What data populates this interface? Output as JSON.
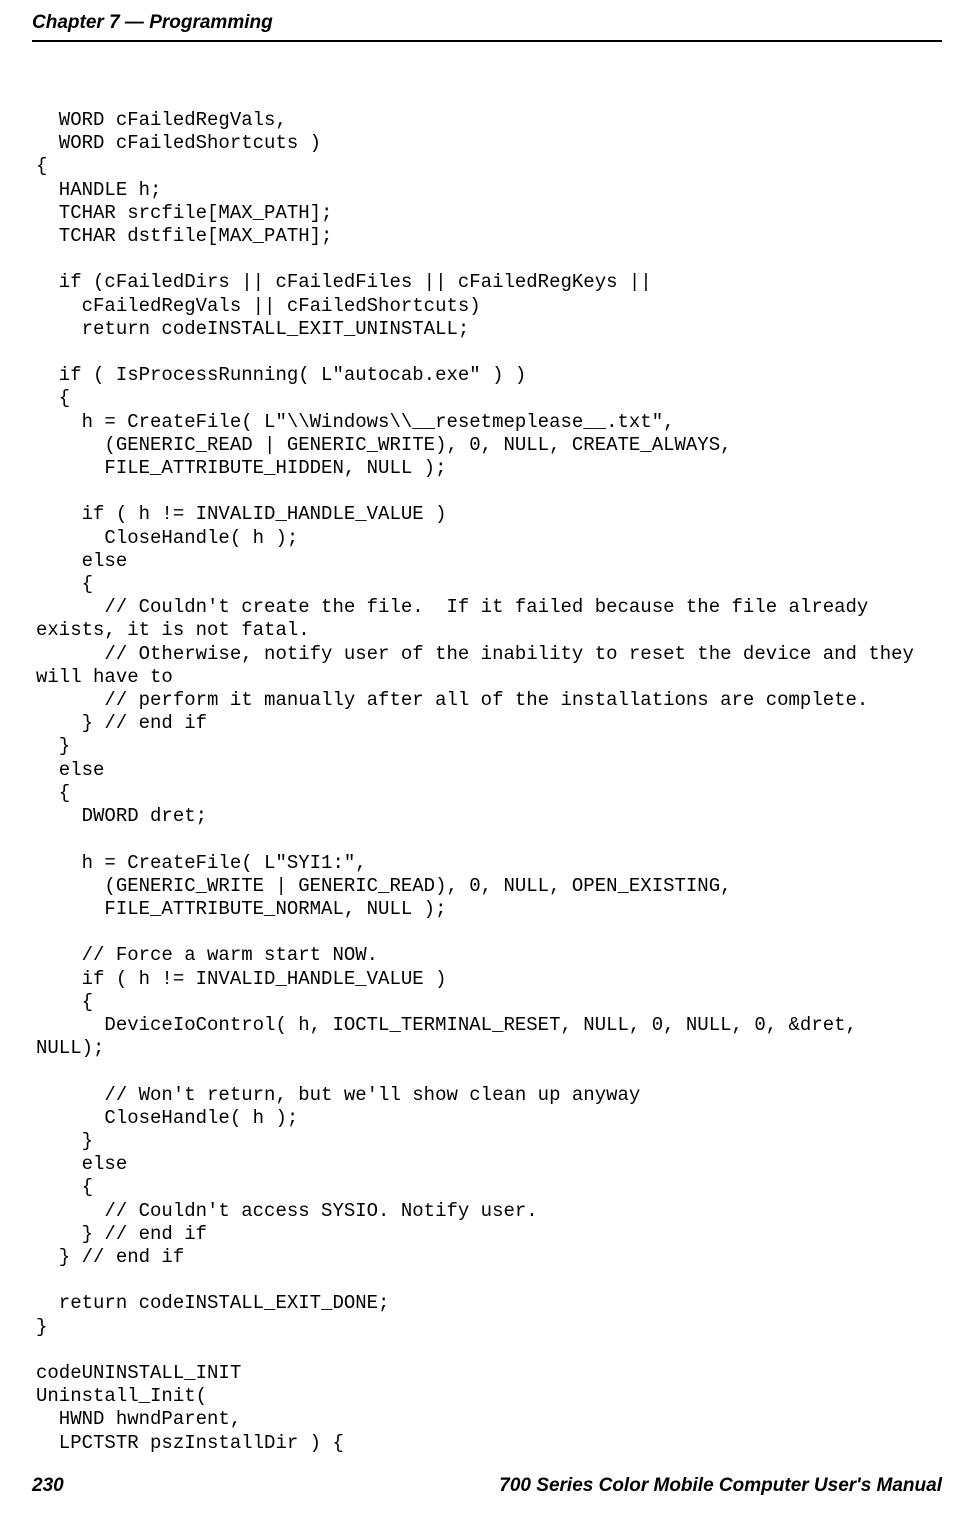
{
  "header": {
    "left": "Chapter 7  —  Programming"
  },
  "code": {
    "lines": [
      "  WORD cFailedRegVals,",
      "  WORD cFailedShortcuts )",
      "{",
      "  HANDLE h;",
      "  TCHAR srcfile[MAX_PATH];",
      "  TCHAR dstfile[MAX_PATH];",
      "",
      "  if (cFailedDirs || cFailedFiles || cFailedRegKeys ||",
      "    cFailedRegVals || cFailedShortcuts)",
      "    return codeINSTALL_EXIT_UNINSTALL;",
      "",
      "  if ( IsProcessRunning( L\"autocab.exe\" ) )",
      "  {",
      "    h = CreateFile( L\"\\\\Windows\\\\__resetmeplease__.txt\",",
      "      (GENERIC_READ | GENERIC_WRITE), 0, NULL, CREATE_ALWAYS,",
      "      FILE_ATTRIBUTE_HIDDEN, NULL );",
      "",
      "    if ( h != INVALID_HANDLE_VALUE )",
      "      CloseHandle( h );",
      "    else",
      "    {",
      "      // Couldn't create the file.  If it failed because the file already",
      "exists, it is not fatal.",
      "      // Otherwise, notify user of the inability to reset the device and they",
      "will have to",
      "      // perform it manually after all of the installations are complete.",
      "    } // end if",
      "  }",
      "  else",
      "  {",
      "    DWORD dret;",
      "",
      "    h = CreateFile( L\"SYI1:\",",
      "      (GENERIC_WRITE | GENERIC_READ), 0, NULL, OPEN_EXISTING,",
      "      FILE_ATTRIBUTE_NORMAL, NULL );",
      "",
      "    // Force a warm start NOW.",
      "    if ( h != INVALID_HANDLE_VALUE )",
      "    {",
      "      DeviceIoControl( h, IOCTL_TERMINAL_RESET, NULL, 0, NULL, 0, &dret,",
      "NULL);",
      "",
      "      // Won't return, but we'll show clean up anyway",
      "      CloseHandle( h );",
      "    }",
      "    else",
      "    {",
      "      // Couldn't access SYSIO. Notify user.",
      "    } // end if",
      "  } // end if",
      "",
      "  return codeINSTALL_EXIT_DONE;",
      "}",
      "",
      "codeUNINSTALL_INIT",
      "Uninstall_Init(",
      "  HWND hwndParent,",
      "  LPCTSTR pszInstallDir ) {"
    ]
  },
  "footer": {
    "page": "230",
    "text": "700 Series Color Mobile Computer User's Manual"
  }
}
